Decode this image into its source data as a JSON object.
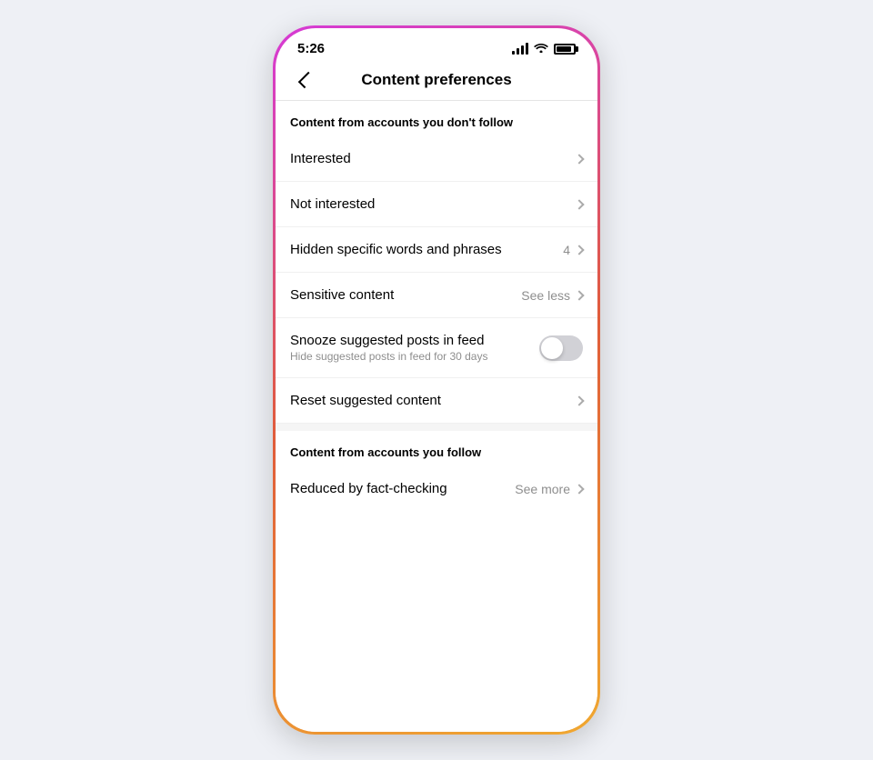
{
  "statusBar": {
    "time": "5:26"
  },
  "header": {
    "title": "Content preferences",
    "backLabel": "Back"
  },
  "sections": [
    {
      "id": "not-follow",
      "label": "Content from accounts you don't follow",
      "items": [
        {
          "id": "interested",
          "label": "Interested",
          "sublabel": "",
          "rightText": "",
          "rightBadge": "",
          "hasChevron": true,
          "hasToggle": false,
          "toggleState": false
        },
        {
          "id": "not-interested",
          "label": "Not interested",
          "sublabel": "",
          "rightText": "",
          "rightBadge": "",
          "hasChevron": true,
          "hasToggle": false,
          "toggleState": false
        },
        {
          "id": "hidden-words",
          "label": "Hidden specific words and phrases",
          "sublabel": "",
          "rightText": "",
          "rightBadge": "4",
          "hasChevron": true,
          "hasToggle": false,
          "toggleState": false
        },
        {
          "id": "sensitive-content",
          "label": "Sensitive content",
          "sublabel": "",
          "rightText": "See less",
          "rightBadge": "",
          "hasChevron": true,
          "hasToggle": false,
          "toggleState": false
        },
        {
          "id": "snooze-suggested",
          "label": "Snooze suggested posts in feed",
          "sublabel": "Hide suggested posts in feed for 30 days",
          "rightText": "",
          "rightBadge": "",
          "hasChevron": false,
          "hasToggle": true,
          "toggleState": false
        },
        {
          "id": "reset-suggested",
          "label": "Reset suggested content",
          "sublabel": "",
          "rightText": "",
          "rightBadge": "",
          "hasChevron": true,
          "hasToggle": false,
          "toggleState": false
        }
      ]
    },
    {
      "id": "follow",
      "label": "Content from accounts you follow",
      "items": [
        {
          "id": "reduced-fact",
          "label": "Reduced by fact-checking",
          "sublabel": "",
          "rightText": "See more",
          "rightBadge": "",
          "hasChevron": true,
          "hasToggle": false,
          "toggleState": false
        }
      ]
    }
  ]
}
